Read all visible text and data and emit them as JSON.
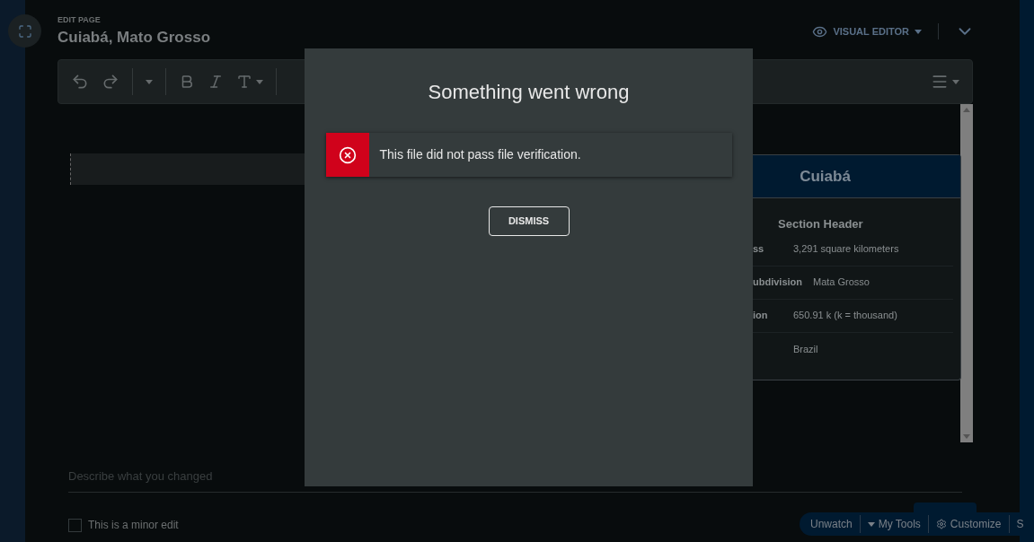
{
  "header": {
    "eyebrow": "EDIT PAGE",
    "title": "Cuiabá, Mato Grosso",
    "mode": "VISUAL EDITOR"
  },
  "infobox": {
    "title": "Cuiabá",
    "section": "Section Header",
    "rows": [
      {
        "label": "ss",
        "value": "3,291 square kilometers"
      },
      {
        "label": "ubdivision",
        "value": "Mata Grosso"
      },
      {
        "label": "ion",
        "value": "650.91 k (k = thousand)"
      },
      {
        "label": "",
        "value": "Brazil"
      }
    ]
  },
  "summary": {
    "placeholder": "Describe what you changed"
  },
  "minor_edit": {
    "label": "This is a minor edit",
    "checked": false
  },
  "bottom_bar": [
    "Unwatch",
    "My Tools",
    "Customize",
    "S"
  ],
  "dialog": {
    "title": "Something went wrong",
    "message": "This file did not pass file verification.",
    "button": "DISMISS"
  }
}
